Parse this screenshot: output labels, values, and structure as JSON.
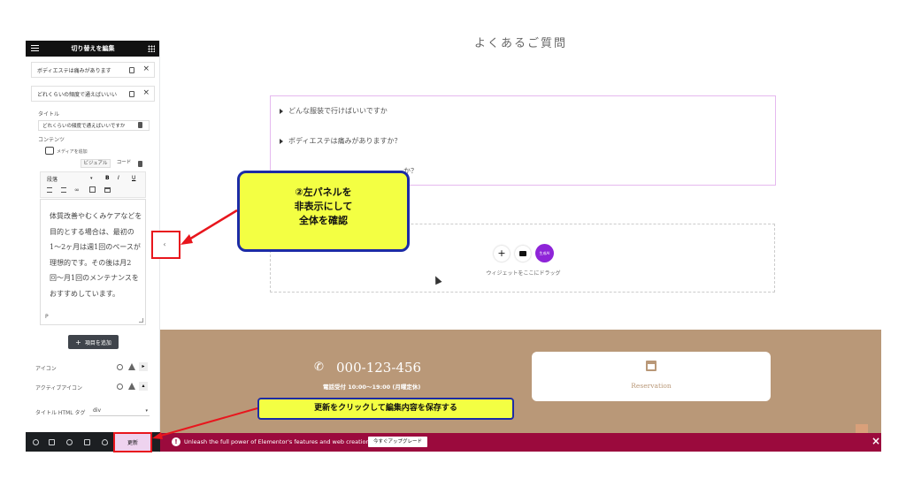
{
  "panel": {
    "title": "切り替えを編集",
    "items": [
      {
        "label": "ボディエステは痛みがあります"
      },
      {
        "label": "どれくらいの頻度で通えばいいい"
      }
    ],
    "title_label": "タイトル",
    "title_value": "どれくらいの頻度で通えばいいですか",
    "content_label": "コンテンツ",
    "add_media": "メディアを追加",
    "tab_visual": "ビジュアル",
    "tab_code": "コード",
    "paragraph_select": "段落",
    "fmt_bold": "B",
    "fmt_italic": "I",
    "fmt_underline": "U",
    "editor_text": "体質改善やむくみケアなどを目的とする場合は、最初の1〜2ヶ月は週1回のペースが理想的です。その後は月2回〜月1回のメンテナンスをおすすめしています。",
    "editor_status": "P",
    "add_item_button": "項目を追加",
    "add_item_icon": "+",
    "icon_label": "アイコン",
    "active_icon_label": "アクティブアイコン",
    "html_tag_label": "タイトル HTML タグ",
    "html_tag_value": "div",
    "update_button": "更新"
  },
  "page": {
    "heading": "よくあるご質問",
    "faq": [
      {
        "q": "どんな服装で行けばいいですか"
      },
      {
        "q": "ボディエステは痛みがありますか？"
      },
      {
        "q": "か？"
      }
    ],
    "dropzone_text": "ウィジェットをここにドラッグ",
    "dropzone_plus": "+",
    "dropzone_ai_label": "生成AI",
    "phone": "000-123-456",
    "hours": "電話受付 10:00〜19:00 (月曜定休)",
    "reservation": "Reservation",
    "collapse_arrow": "‹"
  },
  "promo": {
    "text": "Unleash the full power of Elementor's features and web creation tools.",
    "button": "今すぐアップグレード",
    "close": "×",
    "badge": "!"
  },
  "annotations": {
    "callout1_line1": "②左パネルを",
    "callout1_line2": "非表示にして",
    "callout1_line3": "全体を確認",
    "callout2": "更新をクリックして編集内容を保存する"
  },
  "colors": {
    "accent_purple": "#8e24d8",
    "promo_bg": "#9b0a3d",
    "callout_yellow": "#f3ff43",
    "callout_border": "#1c2ba6",
    "annotation_red": "#e8161d",
    "footer_brown": "#b99878"
  }
}
